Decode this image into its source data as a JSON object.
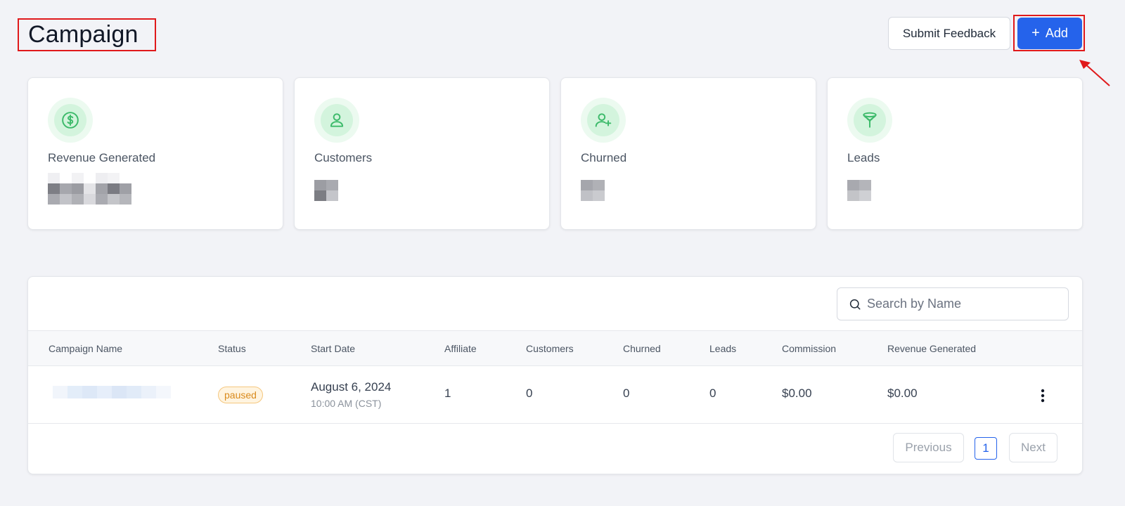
{
  "header": {
    "title": "Campaign",
    "submit_feedback_label": "Submit Feedback",
    "add_label": "Add"
  },
  "stats": [
    {
      "label": "Revenue Generated",
      "icon": "dollar-circle-icon"
    },
    {
      "label": "Customers",
      "icon": "user-icon"
    },
    {
      "label": "Churned",
      "icon": "user-plus-icon"
    },
    {
      "label": "Leads",
      "icon": "funnel-icon"
    }
  ],
  "search": {
    "placeholder": "Search by Name"
  },
  "table": {
    "columns": [
      "Campaign Name",
      "Status",
      "Start Date",
      "Affiliate",
      "Customers",
      "Churned",
      "Leads",
      "Commission",
      "Revenue Generated"
    ],
    "rows": [
      {
        "status": "paused",
        "start_date": "August 6, 2024",
        "start_time": "10:00 AM (CST)",
        "affiliate": "1",
        "customers": "0",
        "churned": "0",
        "leads": "0",
        "commission": "$0.00",
        "revenue": "$0.00"
      }
    ]
  },
  "pagination": {
    "previous_label": "Previous",
    "next_label": "Next",
    "current_page": "1"
  },
  "colors": {
    "accent": "#2563eb",
    "highlight": "#e0191b",
    "icon_green": "#3cba6a",
    "paused": "#d98a1c"
  }
}
